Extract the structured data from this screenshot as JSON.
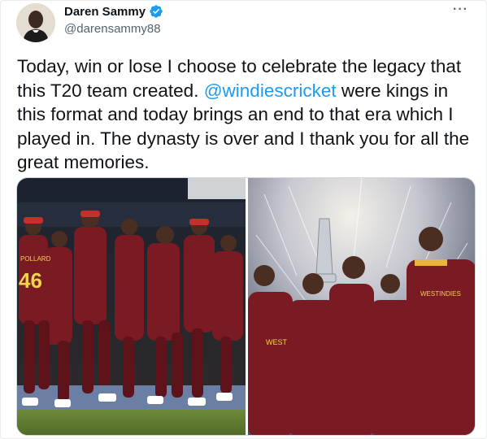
{
  "author": {
    "display_name": "Daren Sammy",
    "handle": "@darensammy88",
    "verified_icon": "verified-badge-icon",
    "verified_color": "#1d9bf0"
  },
  "tweet": {
    "text_before": "Today, win or lose I choose to celebrate the legacy that this T20 team created. ",
    "mention": "@windiescricket",
    "text_after": " were kings in this format and today brings an end to that era which I played in. The dynasty is over and I thank you for all the great memories."
  },
  "menu": {
    "more_label": "···"
  },
  "media": {
    "left_jersey_name": "POLLARD",
    "left_jersey_number": "46",
    "right_jersey_text": "WESTINDIES",
    "right_jersey_text_2": "WEST"
  },
  "colors": {
    "maroon": "#7a1a22",
    "link": "#1d9bf0",
    "secondary_text": "#536471"
  }
}
